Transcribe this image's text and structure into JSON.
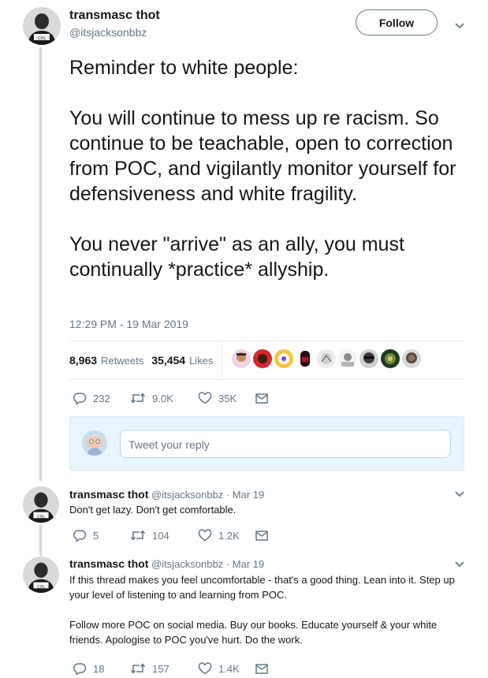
{
  "main_tweet": {
    "author_name": "transmasc thot",
    "author_handle": "@itsjacksonbbz",
    "follow_label": "Follow",
    "paragraphs": [
      "Reminder to white people:",
      "You will continue to mess up re racism. So continue to be teachable, open to correction from POC, and vigilantly monitor yourself for defensiveness and white fragility.",
      "You never \"arrive\" as an ally, you must continually *practice* allyship."
    ],
    "timestamp": "12:29 PM - 19 Mar 2019",
    "retweets_count": "8,963",
    "retweets_label": "Retweets",
    "likes_count": "35,454",
    "likes_label": "Likes",
    "likers_icons": [
      "avatar-1",
      "avatar-2",
      "avatar-3",
      "avatar-4",
      "avatar-5",
      "avatar-6",
      "avatar-7",
      "avatar-8",
      "avatar-9"
    ],
    "actions": {
      "replies": "232",
      "retweets": "9.0K",
      "likes": "35K"
    }
  },
  "reply_composer": {
    "placeholder": "Tweet your reply"
  },
  "replies": [
    {
      "author_name": "transmasc thot",
      "author_handle": "@itsjacksonbbz",
      "date": "· Mar 19",
      "paragraphs": [
        "Don't get lazy. Don't get comfortable."
      ],
      "actions": {
        "replies": "5",
        "retweets": "104",
        "likes": "1.2K"
      }
    },
    {
      "author_name": "transmasc thot",
      "author_handle": "@itsjacksonbbz",
      "date": "· Mar 19",
      "paragraphs": [
        "If this thread makes you feel uncomfortable - that's a good thing. Lean into it. Step up your level of listening to and learning from POC.",
        "Follow more POC on social media. Buy our books. Educate yourself & your white friends. Apologise to POC you've hurt. Do the work."
      ],
      "actions": {
        "replies": "18",
        "retweets": "157",
        "likes": "1.4K"
      }
    }
  ],
  "colors": {
    "muted": "#657786",
    "text": "#14171a",
    "divider": "#e6ecf0",
    "reply_bg": "#e8f5fd"
  }
}
